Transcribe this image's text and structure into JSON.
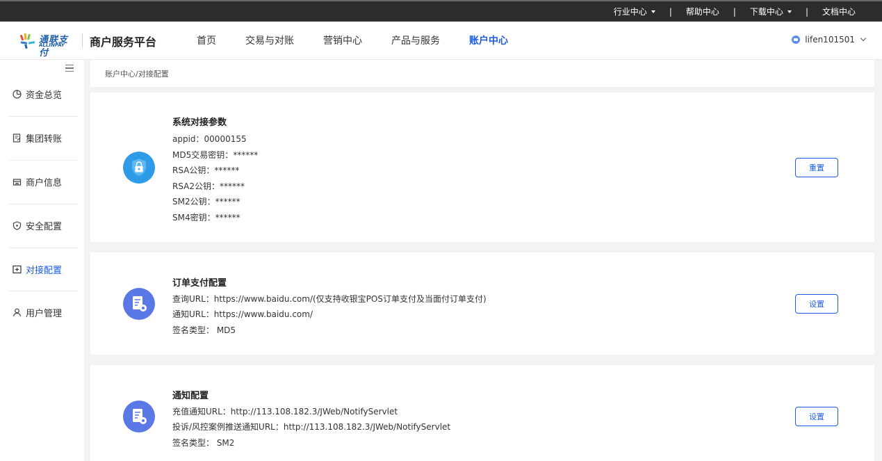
{
  "topbar": {
    "links": [
      {
        "label": "行业中心",
        "dropdown": true
      },
      {
        "label": "帮助中心",
        "dropdown": false
      },
      {
        "label": "下载中心",
        "dropdown": true
      },
      {
        "label": "文档中心",
        "dropdown": false
      }
    ],
    "separator": "|"
  },
  "header": {
    "brand_cn": "通联支付",
    "brand_en": "ALLINPAY",
    "platform": "商户服务平台",
    "nav": [
      "首页",
      "交易与对账",
      "营销中心",
      "产品与服务",
      "账户中心"
    ],
    "active_nav": "账户中心",
    "user": "lifen101501"
  },
  "sidebar": {
    "items": [
      {
        "label": "资金总览",
        "icon": "pie-clock-icon"
      },
      {
        "label": "集团转账",
        "icon": "document-edit-icon"
      },
      {
        "label": "商户信息",
        "icon": "store-icon"
      },
      {
        "label": "安全配置",
        "icon": "shield-icon"
      },
      {
        "label": "对接配置",
        "icon": "connect-icon"
      },
      {
        "label": "用户管理",
        "icon": "user-icon"
      }
    ],
    "active": "对接配置"
  },
  "breadcrumb": "账户中心/对接配置",
  "cards": {
    "system": {
      "title": "系统对接参数",
      "lines": [
        "appid：00000155",
        "MD5交易密钥：******",
        "RSA公钥：******",
        "RSA2公钥：******",
        "SM2公钥：******",
        "SM4密钥：******"
      ],
      "button": "重置",
      "icon": "lock-icon"
    },
    "order": {
      "title": "订单支付配置",
      "lines": [
        "查询URL：https://www.baidu.com/(仅支持收银宝POS订单支付及当面付订单支付)",
        "通知URL：https://www.baidu.com/",
        "签名类型： MD5"
      ],
      "button": "设置",
      "icon": "config-doc-icon"
    },
    "notify": {
      "title": "通知配置",
      "lines": [
        "充值通知URL：http://113.108.182.3/JWeb/NotifyServlet",
        "投诉/风控案例推送通知URL：http://113.108.182.3/JWeb/NotifyServlet",
        "签名类型： SM2"
      ],
      "button": "设置",
      "icon": "config-doc-icon"
    }
  },
  "colors": {
    "accent": "#1a5ce6",
    "topbar": "#2c2c2c",
    "lock_icon": "#2d9be8",
    "doc_icon": "#5a78e6"
  }
}
